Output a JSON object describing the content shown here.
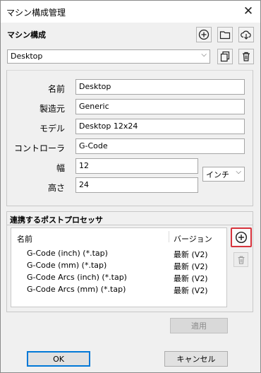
{
  "window": {
    "title": "マシン構成管理"
  },
  "machine_config": {
    "section_title": "マシン構成",
    "selected_machine": "Desktop"
  },
  "fields": {
    "name_label": "名前",
    "name_value": "Desktop",
    "maker_label": "製造元",
    "maker_value": "Generic",
    "model_label": "モデル",
    "model_value": "Desktop 12x24",
    "controller_label": "コントローラ",
    "controller_value": "G-Code",
    "width_label": "幅",
    "width_value": "12",
    "height_label": "高さ",
    "height_value": "24",
    "unit_value": "インチ"
  },
  "post_processors": {
    "title": "連携するポストプロセッサ",
    "col_name": "名前",
    "col_version": "バージョン",
    "rows": [
      {
        "name": "G-Code (inch) (*.tap)",
        "version": "最新 (V2)"
      },
      {
        "name": "G-Code (mm) (*.tap)",
        "version": "最新 (V2)"
      },
      {
        "name": "G-Code Arcs (inch) (*.tap)",
        "version": "最新 (V2)"
      },
      {
        "name": "G-Code Arcs (mm) (*.tap)",
        "version": "最新 (V2)"
      }
    ]
  },
  "buttons": {
    "apply": "適用",
    "ok": "OK",
    "cancel": "キャンセル"
  },
  "icons": {
    "close": "close-icon",
    "add_machine": "add-circle-icon",
    "open": "folder-icon",
    "cloud": "cloud-download-icon",
    "copy": "copy-icon",
    "delete": "trash-icon",
    "add_processor": "add-circle-icon",
    "delete_processor": "trash-icon"
  },
  "colors": {
    "highlight": "#d7333c",
    "default_button_border": "#0078d7"
  }
}
